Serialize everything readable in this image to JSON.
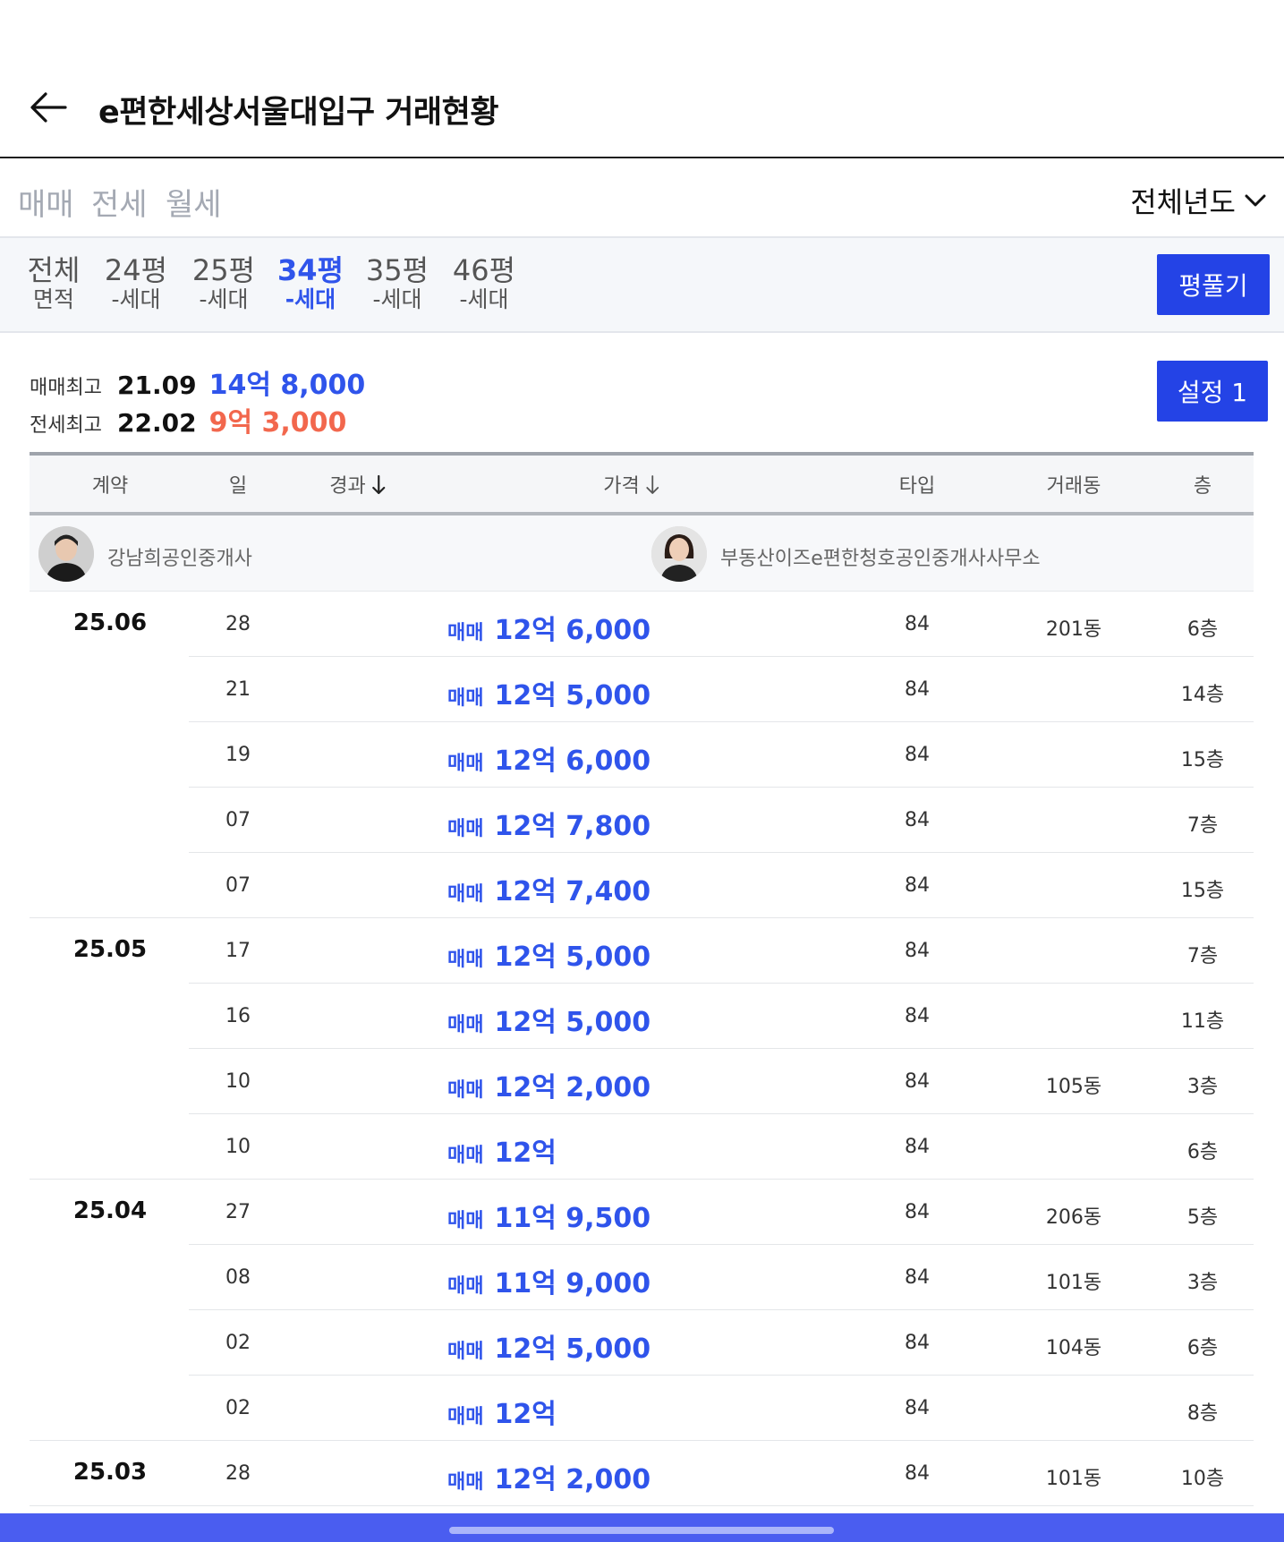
{
  "header": {
    "title": "e편한세상서울대입구 거래현황"
  },
  "deal_tabs": [
    {
      "label": "매매",
      "active": true
    },
    {
      "label": "전세",
      "active": false
    },
    {
      "label": "월세",
      "active": false
    }
  ],
  "year_select": {
    "label": "전체년도"
  },
  "area_tabs": [
    {
      "main": "전체",
      "sub": "면적",
      "active": false
    },
    {
      "main": "24평",
      "sub": "-세대",
      "active": false
    },
    {
      "main": "25평",
      "sub": "-세대",
      "active": false
    },
    {
      "main": "34평",
      "sub": "-세대",
      "active": true
    },
    {
      "main": "35평",
      "sub": "-세대",
      "active": false
    },
    {
      "main": "46평",
      "sub": "-세대",
      "active": false
    }
  ],
  "pyeong_button": "평풀기",
  "setting_button": "설정 1",
  "max_info": {
    "sale": {
      "label": "매매최고",
      "date": "21.09",
      "price": "14억 8,000"
    },
    "jeonse": {
      "label": "전세최고",
      "date": "22.02",
      "price": "9억 3,000"
    }
  },
  "colors": {
    "accent": "#2f54eb",
    "jeonse": "#f2674d",
    "button": "#2443e6"
  },
  "table": {
    "headers": [
      "계약",
      "일",
      "경과",
      "가격",
      "타입",
      "거래동",
      "층"
    ],
    "sort_icon": "arrow-down-icon",
    "agents": [
      {
        "name": "강남희공인중개사"
      },
      {
        "name": "부동산이즈e편한청호공인중개사사무소"
      }
    ],
    "rows": [
      {
        "ym": "25.06",
        "day": "28",
        "tag": "매매",
        "price": "12억 6,000",
        "type": "84",
        "dong": "201동",
        "floor": "6층"
      },
      {
        "ym": "",
        "day": "21",
        "tag": "매매",
        "price": "12억 5,000",
        "type": "84",
        "dong": "",
        "floor": "14층"
      },
      {
        "ym": "",
        "day": "19",
        "tag": "매매",
        "price": "12억 6,000",
        "type": "84",
        "dong": "",
        "floor": "15층"
      },
      {
        "ym": "",
        "day": "07",
        "tag": "매매",
        "price": "12억 7,800",
        "type": "84",
        "dong": "",
        "floor": "7층"
      },
      {
        "ym": "",
        "day": "07",
        "tag": "매매",
        "price": "12억 7,400",
        "type": "84",
        "dong": "",
        "floor": "15층"
      },
      {
        "ym": "25.05",
        "day": "17",
        "tag": "매매",
        "price": "12억 5,000",
        "type": "84",
        "dong": "",
        "floor": "7층"
      },
      {
        "ym": "",
        "day": "16",
        "tag": "매매",
        "price": "12억 5,000",
        "type": "84",
        "dong": "",
        "floor": "11층"
      },
      {
        "ym": "",
        "day": "10",
        "tag": "매매",
        "price": "12억 2,000",
        "type": "84",
        "dong": "105동",
        "floor": "3층"
      },
      {
        "ym": "",
        "day": "10",
        "tag": "매매",
        "price": "12억",
        "type": "84",
        "dong": "",
        "floor": "6층"
      },
      {
        "ym": "25.04",
        "day": "27",
        "tag": "매매",
        "price": "11억 9,500",
        "type": "84",
        "dong": "206동",
        "floor": "5층"
      },
      {
        "ym": "",
        "day": "08",
        "tag": "매매",
        "price": "11억 9,000",
        "type": "84",
        "dong": "101동",
        "floor": "3층"
      },
      {
        "ym": "",
        "day": "02",
        "tag": "매매",
        "price": "12억 5,000",
        "type": "84",
        "dong": "104동",
        "floor": "6층"
      },
      {
        "ym": "",
        "day": "02",
        "tag": "매매",
        "price": "12억",
        "type": "84",
        "dong": "",
        "floor": "8층"
      },
      {
        "ym": "25.03",
        "day": "28",
        "tag": "매매",
        "price": "12억 2,000",
        "type": "84",
        "dong": "101동",
        "floor": "10층"
      }
    ]
  }
}
